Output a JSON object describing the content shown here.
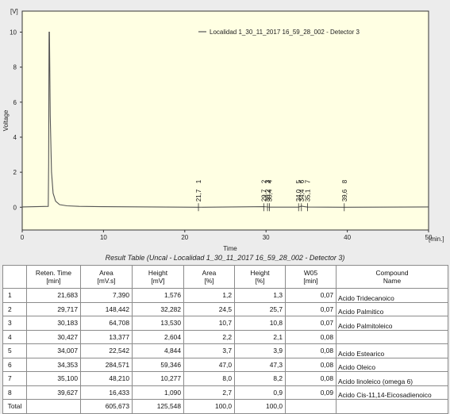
{
  "chart_data": {
    "type": "line",
    "title": "",
    "xlabel": "Time",
    "ylabel": "Voltage",
    "x_unit": "[min.]",
    "y_unit": "[V]",
    "xlim": [
      0,
      50
    ],
    "ylim": [
      -1.3,
      11.2
    ],
    "x_ticks": [
      "0",
      "10",
      "20",
      "30",
      "40",
      "50"
    ],
    "y_ticks": [
      "0",
      "2",
      "4",
      "6",
      "8",
      "10"
    ],
    "grid": false,
    "legend_position": "top-right",
    "series": [
      {
        "name": "Localidad 1_30_11_2017 16_59_28_002 - Detector 3",
        "color": "#555555",
        "x": [
          0,
          3.2,
          3.25,
          3.3,
          3.35,
          3.45,
          3.6,
          3.8,
          4.1,
          4.6,
          5.5,
          7,
          10,
          21.683,
          29.717,
          30.183,
          30.427,
          34.007,
          34.353,
          35.1,
          39.627,
          50
        ],
        "y": [
          0.02,
          0.05,
          2.5,
          10.0,
          10.0,
          5.2,
          2.0,
          0.8,
          0.35,
          0.15,
          0.08,
          0.05,
          0.03,
          0.0016,
          0.0323,
          0.0135,
          0.0026,
          0.0048,
          0.0593,
          0.0103,
          0.0011,
          0.02
        ]
      }
    ],
    "peaks": [
      {
        "number": "1",
        "time": "21,7",
        "x": 21.683
      },
      {
        "number": "2",
        "time": "29,7",
        "x": 29.717
      },
      {
        "number": "3",
        "time": "30,2",
        "x": 30.183
      },
      {
        "number": "4",
        "time": "30,4",
        "x": 30.427
      },
      {
        "number": "5",
        "time": "34,0",
        "x": 34.007
      },
      {
        "number": "6",
        "time": "34,4",
        "x": 34.353
      },
      {
        "number": "7",
        "time": "35,1",
        "x": 35.1
      },
      {
        "number": "8",
        "time": "39,6",
        "x": 39.627
      }
    ],
    "colors": {
      "plot_background": "#ffffe3",
      "panel_background": "#ececec",
      "axis": "#333333",
      "trace": "#555555"
    }
  },
  "result_table": {
    "title": "Result Table (Uncal - Localidad 1_30_11_2017 16_59_28_002 - Detector 3)",
    "headers": [
      [
        "",
        ""
      ],
      [
        "Reten. Time",
        "[min]"
      ],
      [
        "Area",
        "[mV.s]"
      ],
      [
        "Height",
        "[mV]"
      ],
      [
        "Area",
        "[%]"
      ],
      [
        "Height",
        "[%]"
      ],
      [
        "W05",
        "[min]"
      ],
      [
        "Compound",
        "Name"
      ]
    ],
    "rows": [
      [
        "1",
        "21,683",
        "7,390",
        "1,576",
        "1,2",
        "1,3",
        "0,07",
        "Acido Tridecanoico"
      ],
      [
        "2",
        "29,717",
        "148,442",
        "32,282",
        "24,5",
        "25,7",
        "0,07",
        "Acido Palmitico"
      ],
      [
        "3",
        "30,183",
        "64,708",
        "13,530",
        "10,7",
        "10,8",
        "0,07",
        "Acido Palmitoleico"
      ],
      [
        "4",
        "30,427",
        "13,377",
        "2,604",
        "2,2",
        "2,1",
        "0,08",
        ""
      ],
      [
        "5",
        "34,007",
        "22,542",
        "4,844",
        "3,7",
        "3,9",
        "0,08",
        "Acido Estearico"
      ],
      [
        "6",
        "34,353",
        "284,571",
        "59,346",
        "47,0",
        "47,3",
        "0,08",
        "Acido Oleico"
      ],
      [
        "7",
        "35,100",
        "48,210",
        "10,277",
        "8,0",
        "8,2",
        "0,08",
        "Acido linoleico (omega 6)"
      ],
      [
        "8",
        "39,627",
        "16,433",
        "1,090",
        "2,7",
        "0,9",
        "0,09",
        "Acido Cis-11,14-Eicosadienoico"
      ]
    ],
    "total_row": [
      "Total",
      "",
      "605,673",
      "125,548",
      "100,0",
      "100,0",
      "",
      ""
    ]
  }
}
